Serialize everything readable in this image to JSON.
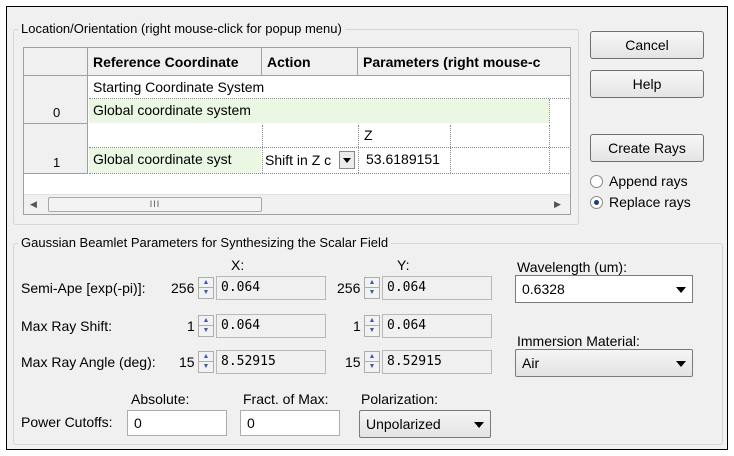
{
  "location": {
    "title": "Location/Orientation (right mouse-click for popup menu)",
    "columns": [
      "Reference Coordinate",
      "Action",
      "Parameters (right mouse-c"
    ],
    "rows": [
      {
        "index": "0",
        "top_text": "Starting Coordinate System",
        "cell": "Global coordinate system"
      },
      {
        "index": "1",
        "param_label": "Z",
        "reference": "Global coordinate syst",
        "action": "Shift in Z c",
        "param_value": "53.6189151"
      }
    ],
    "scroll_thumb": "III"
  },
  "buttons": {
    "cancel": "Cancel",
    "help": "Help",
    "create_rays": "Create Rays"
  },
  "ray_options": {
    "append": "Append rays",
    "replace": "Replace rays",
    "selected": "replace"
  },
  "gaussian": {
    "title": "Gaussian Beamlet Parameters for Synthesizing the Scalar Field",
    "x_header": "X:",
    "y_header": "Y:",
    "rows": [
      {
        "label": "Semi-Ape [exp(-pi)]:",
        "x_spin": "256",
        "x_value": "0.064",
        "y_spin": "256",
        "y_value": "0.064"
      },
      {
        "label": "Max Ray Shift:",
        "x_spin": "1",
        "x_value": "0.064",
        "y_spin": "1",
        "y_value": "0.064"
      },
      {
        "label": "Max Ray Angle (deg):",
        "x_spin": "15",
        "x_value": "8.52915",
        "y_spin": "15",
        "y_value": "8.52915"
      }
    ],
    "wavelength_label": "Wavelength (um):",
    "wavelength_value": "0.6328",
    "immersion_label": "Immersion Material:",
    "immersion_value": "Air",
    "absolute_label": "Absolute:",
    "fract_label": "Fract. of Max:",
    "polarization_label": "Polarization:",
    "power_cutoffs_label": "Power Cutoffs:",
    "absolute_value": "0",
    "fract_value": "0",
    "polarization_value": "Unpolarized"
  }
}
